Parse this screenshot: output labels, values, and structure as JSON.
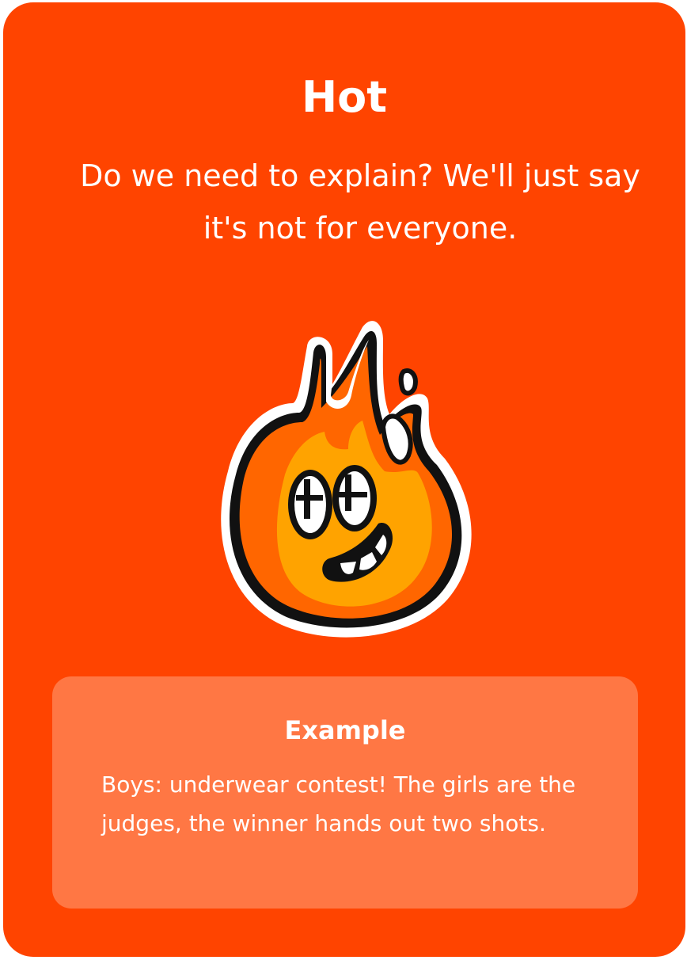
{
  "card": {
    "title": "Hot",
    "description": "Do we need to explain? We'll just say it's not for everyone.",
    "background_color": "#FF4400",
    "mascot_icon": "flame-mascot-icon"
  },
  "example": {
    "heading": "Example",
    "text": "Boys: underwear contest! The girls are the judges, the winner hands out two shots.",
    "background_color": "#FF7744"
  }
}
